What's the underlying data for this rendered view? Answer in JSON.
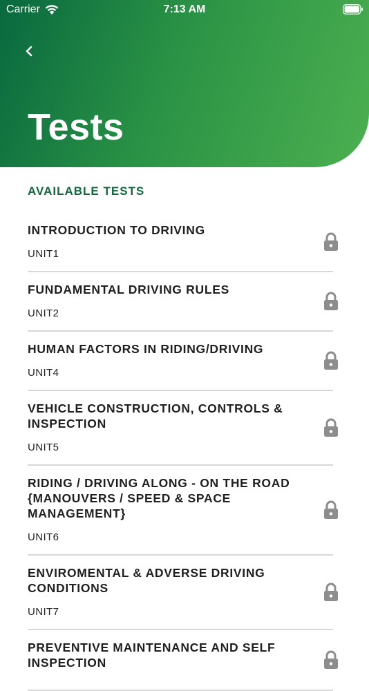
{
  "status_bar": {
    "carrier": "Carrier",
    "time": "7:13 AM"
  },
  "header": {
    "title": "Tests",
    "back_icon": "chevron-left-icon",
    "gradient_colors": [
      "#08693f",
      "#4cb050"
    ]
  },
  "section": {
    "title": "AVAILABLE TESTS",
    "color": "#0e6a3c"
  },
  "tests": [
    {
      "title": "INTRODUCTION TO DRIVING",
      "unit": "UNIT1",
      "icon": "lock-icon"
    },
    {
      "title": "FUNDAMENTAL DRIVING RULES",
      "unit": "UNIT2",
      "icon": "lock-icon"
    },
    {
      "title": "HUMAN FACTORS IN RIDING/DRIVING",
      "unit": "UNIT4",
      "icon": "lock-icon"
    },
    {
      "title": "VEHICLE CONSTRUCTION, CONTROLS & INSPECTION",
      "unit": "UNIT5",
      "icon": "lock-icon"
    },
    {
      "title": "RIDING / DRIVING ALONG - ON THE ROAD {MANOUVERS / SPEED & SPACE MANAGEMENT}",
      "unit": "UNIT6",
      "icon": "lock-icon"
    },
    {
      "title": "ENVIROMENTAL & ADVERSE DRIVING CONDITIONS",
      "unit": "UNIT7",
      "icon": "lock-icon"
    },
    {
      "title": "PREVENTIVE MAINTENANCE AND SELF INSPECTION",
      "unit": "",
      "icon": "lock-icon"
    }
  ]
}
